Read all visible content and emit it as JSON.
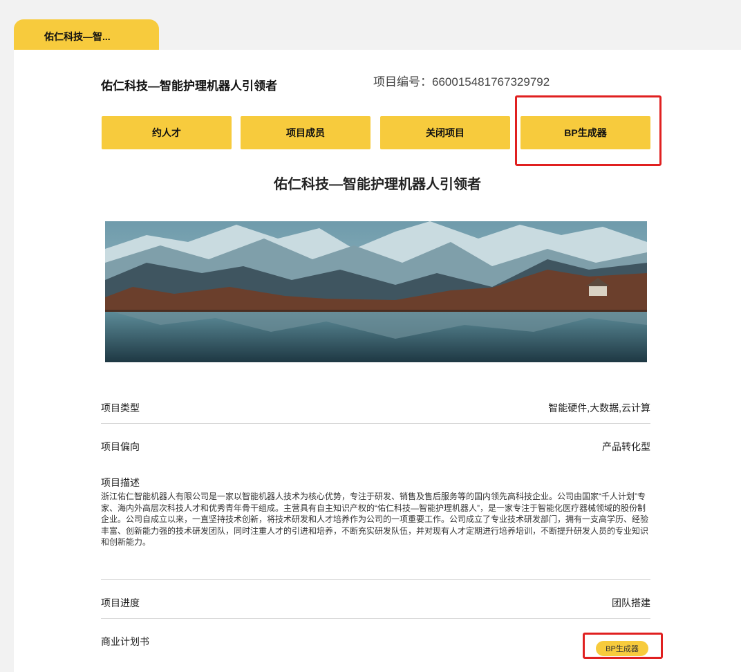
{
  "tab": {
    "label": "佑仁科技—智..."
  },
  "project": {
    "title": "佑仁科技—智能护理机器人引领者",
    "id_label": "项目编号：660015481767329792",
    "hero_title": "佑仁科技—智能护理机器人引领者"
  },
  "actions": {
    "invite_talent": "约人才",
    "members": "项目成员",
    "close_project": "关闭项目",
    "bp_generator": "BP生成器"
  },
  "banner": {
    "icon": "mountain-lake-photo"
  },
  "details": {
    "type_label": "项目类型",
    "type_value": "智能硬件,大数据,云计算",
    "orientation_label": "项目偏向",
    "orientation_value": "产品转化型",
    "description_label": "项目描述",
    "description_text": "浙江佑仁智能机器人有限公司是一家以智能机器人技术为核心优势，专注于研发、销售及售后服务等的国内领先高科技企业。公司由国家“千人计划”专家、海内外高层次科技人才和优秀青年骨干组成。主营具有自主知识产权的“佑仁科技—智能护理机器人”，是一家专注于智能化医疗器械领域的股份制企业。公司自成立以来，一直坚持技术创新，将技术研发和人才培养作为公司的一项重要工作。公司成立了专业技术研发部门，拥有一支高学历、经验丰富、创新能力强的技术研发团队，同时注重人才的引进和培养，不断充实研发队伍，并对现有人才定期进行培养培训，不断提升研发人员的专业知识和创新能力。",
    "progress_label": "项目进度",
    "progress_value": "团队搭建",
    "bp_label": "商业计划书",
    "bp_button": "BP生成器"
  },
  "colors": {
    "accent": "#f7cb3d",
    "highlight": "#e02020"
  }
}
